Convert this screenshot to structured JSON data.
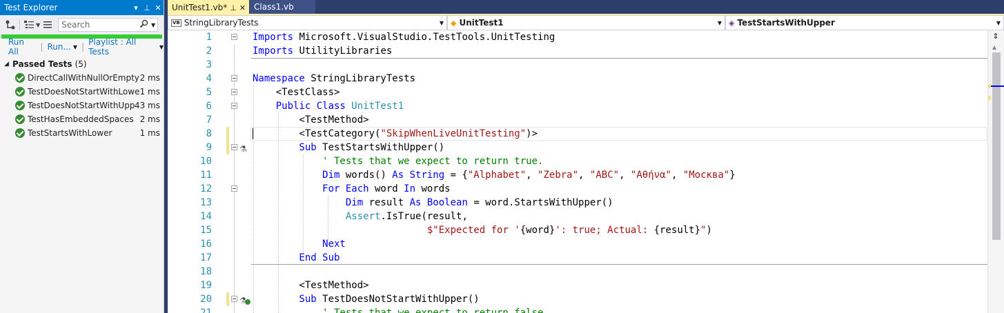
{
  "test_explorer": {
    "title": "Test Explorer",
    "search_placeholder": "Search",
    "run_all": "Run All",
    "run": "Run...",
    "playlist": "Playlist : All Tests",
    "group_label": "Passed Tests",
    "group_count": "(5)",
    "tests": [
      {
        "name": "DirectCallWithNullOrEmpty",
        "duration": "2 ms"
      },
      {
        "name": "TestDoesNotStartWithLower",
        "duration": "1 ms"
      },
      {
        "name": "TestDoesNotStartWithUpper",
        "duration": "43 ms"
      },
      {
        "name": "TestHasEmbeddedSpaces",
        "duration": "2 ms"
      },
      {
        "name": "TestStartsWithLower",
        "duration": "1 ms"
      }
    ]
  },
  "editor": {
    "tabs": [
      {
        "name": "UnitTest1.vb*"
      },
      {
        "name": "Class1.vb"
      }
    ],
    "nav": {
      "project": "StringLibraryTests",
      "class": "UnitTest1",
      "member": "TestStartsWithUpper"
    }
  },
  "code_lines": [
    {
      "n": "1",
      "spans": [
        [
          "kw",
          "Imports"
        ],
        [
          "",
          "Microsoft.VisualStudio.TestTools.UnitTesting"
        ]
      ]
    },
    {
      "n": "2",
      "spans": [
        [
          "kw",
          "Imports"
        ],
        [
          "",
          "UtilityLibraries"
        ]
      ]
    },
    {
      "n": "3",
      "spans": []
    },
    {
      "n": "4",
      "spans": [
        [
          "kw",
          "Namespace"
        ],
        [
          "",
          " StringLibraryTests"
        ]
      ]
    },
    {
      "n": "5",
      "spans": [
        [
          "",
          "    <TestClass>"
        ]
      ]
    },
    {
      "n": "6",
      "spans": [
        [
          "kw",
          "    Public Class"
        ],
        [
          "",
          ""
        ],
        [
          "ty",
          " UnitTest1"
        ]
      ]
    },
    {
      "n": "7",
      "spans": [
        [
          "",
          "        <TestMethod>"
        ]
      ]
    },
    {
      "n": "8",
      "spans": [
        [
          "",
          "        <TestCategory("
        ],
        [
          "str",
          "\"SkipWhenLiveUnitTesting\""
        ],
        [
          "",
          ")>"
        ]
      ]
    },
    {
      "n": "9",
      "spans": [
        [
          "kw",
          "        Sub"
        ],
        [
          "",
          " TestStartsWithUpper()"
        ]
      ]
    },
    {
      "n": "10",
      "spans": [
        [
          "cm",
          "            ' Tests that we expect to return true."
        ]
      ]
    },
    {
      "n": "11",
      "spans": [
        [
          "kw",
          "            Dim"
        ],
        [
          "",
          " words() "
        ],
        [
          "kw",
          "As String"
        ],
        [
          "",
          " = {"
        ],
        [
          "str",
          "\"Alphabet\""
        ],
        [
          "",
          ", "
        ],
        [
          "str",
          "\"Zebra\""
        ],
        [
          "",
          ", "
        ],
        [
          "str",
          "\"ABC\""
        ],
        [
          "",
          ", "
        ],
        [
          "str",
          "\"Αθήνα\""
        ],
        [
          "",
          ", "
        ],
        [
          "str",
          "\"Москва\""
        ],
        [
          "",
          "}"
        ]
      ]
    },
    {
      "n": "12",
      "spans": [
        [
          "kw",
          "            For Each"
        ],
        [
          "",
          " word "
        ],
        [
          "kw",
          "In"
        ],
        [
          "",
          " words"
        ]
      ]
    },
    {
      "n": "13",
      "spans": [
        [
          "kw",
          "                Dim"
        ],
        [
          "",
          " result "
        ],
        [
          "kw",
          "As Boolean"
        ],
        [
          "",
          " = word.StartsWithUpper()"
        ]
      ]
    },
    {
      "n": "14",
      "spans": [
        [
          "ty",
          "                Assert"
        ],
        [
          "",
          ".IsTrue(result,"
        ]
      ]
    },
    {
      "n": "15",
      "spans": [
        [
          "",
          "                              "
        ],
        [
          "str",
          "$\"Expected for '"
        ],
        [
          "",
          "{word}"
        ],
        [
          "str",
          "': true; Actual: "
        ],
        [
          "",
          "{result}"
        ],
        [
          "str",
          "\""
        ],
        [
          "",
          ")"
        ]
      ]
    },
    {
      "n": "16",
      "spans": [
        [
          "kw",
          "            Next"
        ]
      ]
    },
    {
      "n": "17",
      "spans": [
        [
          "kw",
          "        End Sub"
        ]
      ]
    },
    {
      "n": "18",
      "spans": []
    },
    {
      "n": "19",
      "spans": [
        [
          "",
          "        <TestMethod>"
        ]
      ]
    },
    {
      "n": "20",
      "spans": [
        [
          "kw",
          "        Sub"
        ],
        [
          "",
          " TestDoesNotStartWithUpper()"
        ]
      ]
    },
    {
      "n": "21",
      "spans": [
        [
          "cm",
          "            ' Tests that we expect to return false."
        ]
      ]
    }
  ]
}
